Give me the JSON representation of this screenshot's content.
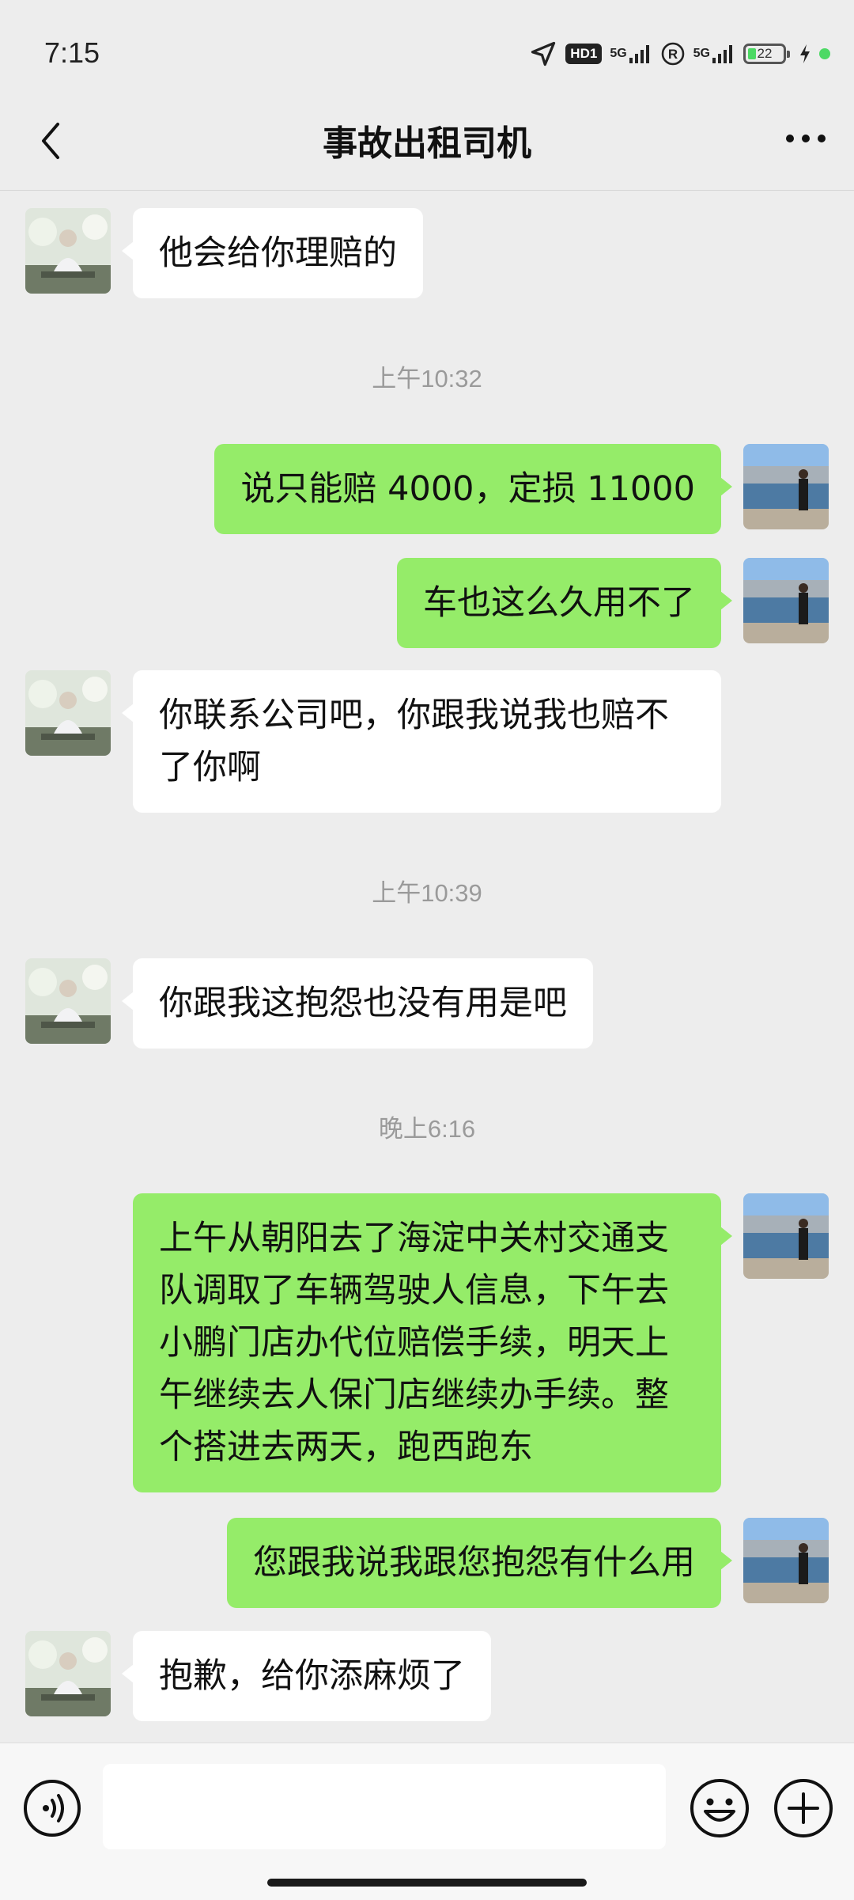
{
  "status_bar": {
    "time": "7:15",
    "hd_badge": "HD1",
    "network_1": "5G",
    "network_2": "5G",
    "battery_level": "22",
    "icons": [
      "location-arrow-icon",
      "hd-voice-icon",
      "signal-5g-icon",
      "registered-icon",
      "signal-5g-icon",
      "battery-icon",
      "charging-icon"
    ]
  },
  "header": {
    "title": "事故出租司机",
    "back_icon": "chevron-left-icon",
    "more_icon": "more-dots-icon"
  },
  "messages": [
    {
      "type": "msg",
      "side": "recv",
      "text": "他会给你理赔的"
    },
    {
      "type": "time",
      "text": "上午10:32"
    },
    {
      "type": "msg",
      "side": "sent",
      "text": "说只能赔 4000，定损 11000"
    },
    {
      "type": "msg",
      "side": "sent",
      "text": "车也这么久用不了"
    },
    {
      "type": "msg",
      "side": "recv",
      "text": "你联系公司吧，你跟我说我也赔不了你啊"
    },
    {
      "type": "time",
      "text": "上午10:39"
    },
    {
      "type": "msg",
      "side": "recv",
      "text": "你跟我这抱怨也没有用是吧"
    },
    {
      "type": "time",
      "text": "晚上6:16"
    },
    {
      "type": "msg",
      "side": "sent",
      "text": "上午从朝阳去了海淀中关村交通支队调取了车辆驾驶人信息，下午去小鹏门店办代位赔偿手续，明天上午继续去人保门店继续办手续。整个搭进去两天，跑西跑东"
    },
    {
      "type": "msg",
      "side": "sent",
      "text": "您跟我说我跟您抱怨有什么用"
    },
    {
      "type": "msg",
      "side": "recv",
      "text": "抱歉，给你添麻烦了"
    }
  ],
  "input_bar": {
    "voice_icon": "voice-input-icon",
    "placeholder": "",
    "emoji_icon": "emoji-icon",
    "plus_icon": "plus-circle-icon"
  },
  "colors": {
    "background": "#ededed",
    "sent_bubble": "#95ec69",
    "recv_bubble": "#ffffff",
    "timestamp": "#9a9a9a"
  }
}
